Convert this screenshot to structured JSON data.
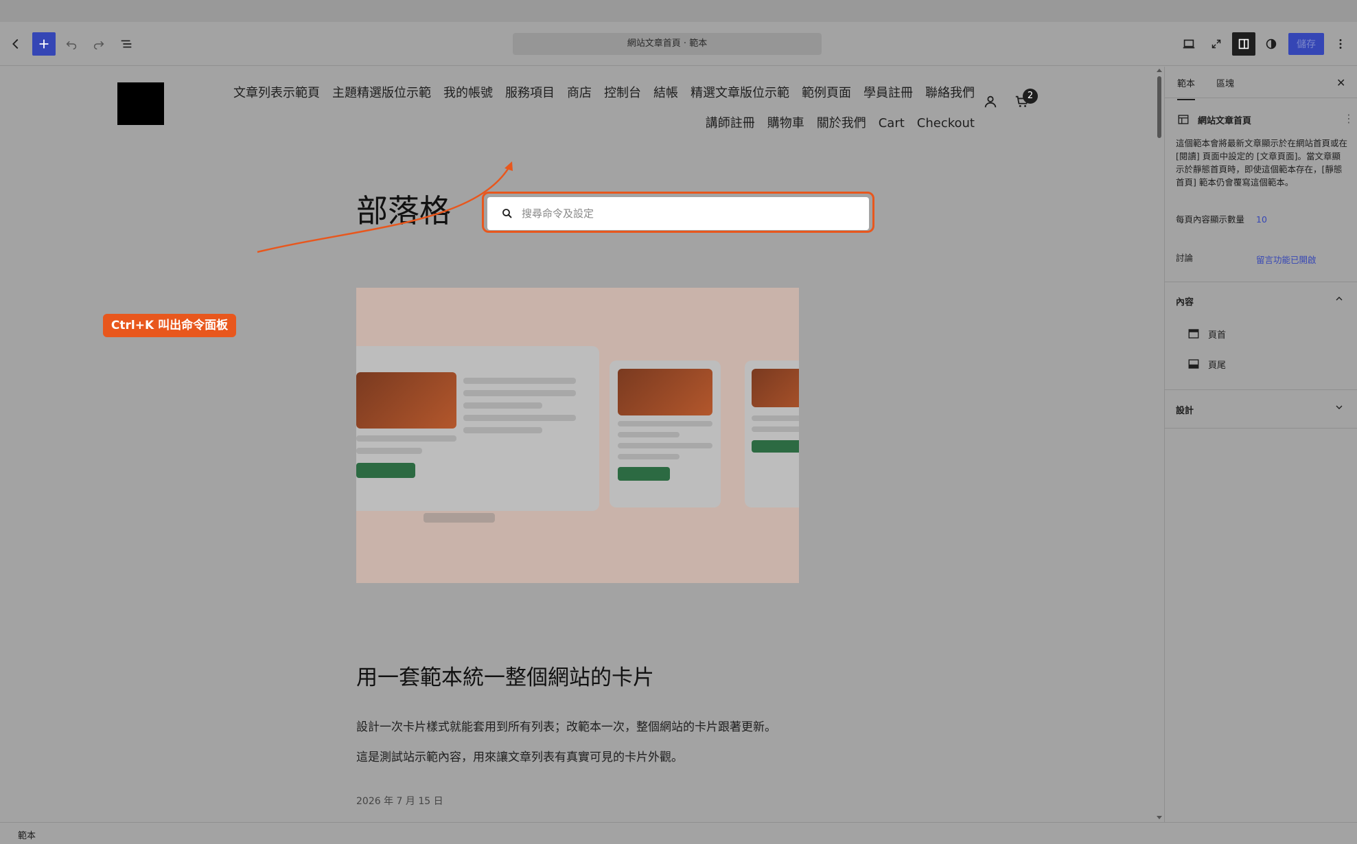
{
  "toolbar": {
    "document_title": "網站文章首頁 · 範本",
    "save_label": "儲存",
    "icons": [
      "back-icon",
      "plus-icon",
      "undo-icon",
      "redo-icon",
      "list-view-icon",
      "desktop-view-icon",
      "fullscreen-icon",
      "sidebar-icon",
      "contrast-icon",
      "more-options-icon"
    ]
  },
  "site": {
    "nav_row1": [
      "文章列表示範頁",
      "主題精選版位示範",
      "我的帳號",
      "服務項目",
      "商店",
      "控制台",
      "結帳",
      "精選文章版位示範",
      "範例頁面",
      "學員註冊",
      "聯絡我們"
    ],
    "nav_row2": [
      "講師註冊",
      "購物車",
      "關於我們",
      "Cart",
      "Checkout"
    ],
    "cart_count": "2"
  },
  "page": {
    "heading": "部落格",
    "post_title": "用一套範本統一整個網站的卡片",
    "excerpt_line1": "設計一次卡片樣式就能套用到所有列表；改範本一次，整個網站的卡片跟著更新。",
    "excerpt_line2": "這是測試站示範內容，用來讓文章列表有真實可見的卡片外觀。",
    "date": "2026 年 7 月 15 日"
  },
  "annotation": {
    "label": "Ctrl+K 叫出命令面板",
    "color": "#e8571d"
  },
  "command_palette": {
    "placeholder": "搜尋命令及設定",
    "value": ""
  },
  "sidebar": {
    "tabs": [
      "範本",
      "區塊"
    ],
    "active_tab": "範本",
    "template_title": "網站文章首頁",
    "template_description": "這個範本會將最新文章顯示於在網站首頁或在 [閱讀] 頁面中設定的 [文章頁面]。當文章顯示於靜態首頁時，即使這個範本存在，[靜態首頁] 範本仍會覆寫這個範本。",
    "posts_per_page_label": "每頁內容顯示數量",
    "posts_per_page_value": "10",
    "discussion_label": "討論",
    "discussion_value": "留言功能已開啟",
    "content_panel_title": "內容",
    "content_items": [
      "頁首",
      "頁尾"
    ],
    "design_panel_title": "設計"
  },
  "status_bar": {
    "text": "範本"
  },
  "colors": {
    "accent": "#3546b5",
    "annotation": "#e8571d",
    "overlay_bg": "#a3a3a3"
  }
}
